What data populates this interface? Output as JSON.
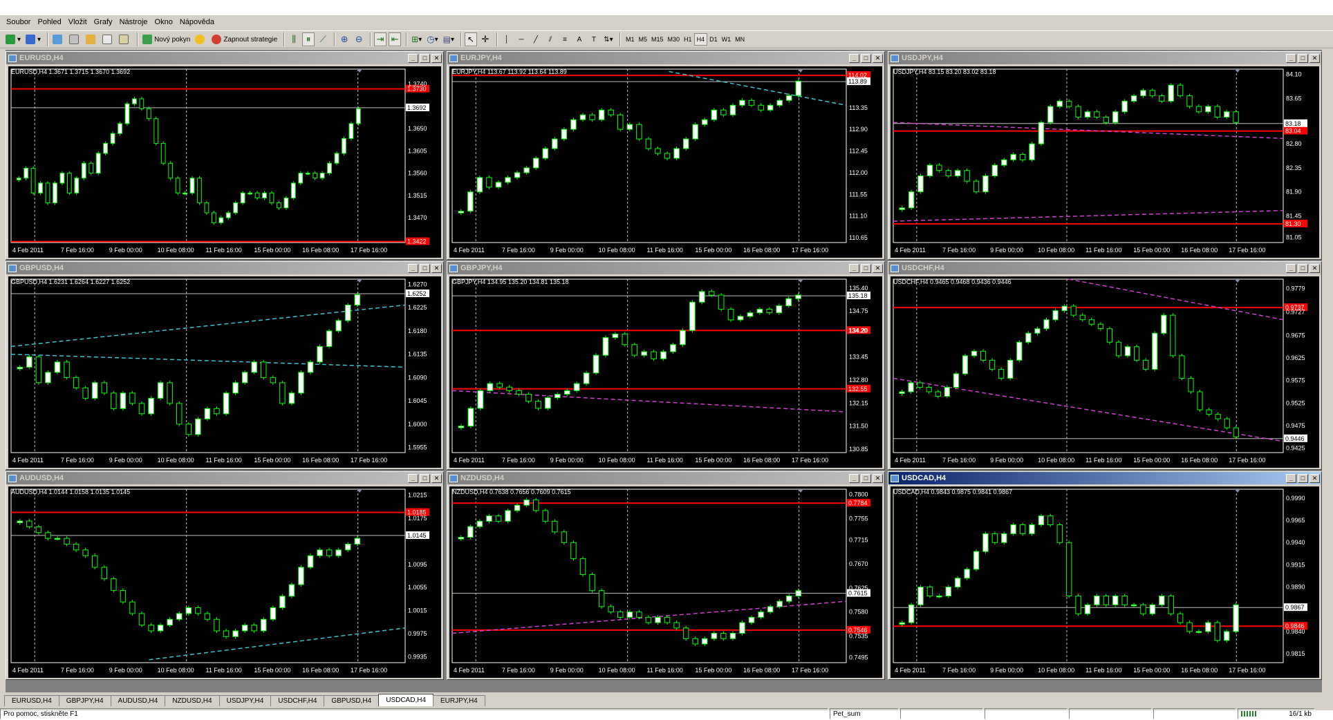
{
  "menu": [
    "Soubor",
    "Pohled",
    "Vložit",
    "Grafy",
    "Nástroje",
    "Okno",
    "Nápověda"
  ],
  "toolbar": {
    "new_order": "Nový pokyn",
    "start_strategies": "Zapnout strategie",
    "timeframes": [
      "M1",
      "M5",
      "M15",
      "M30",
      "H1",
      "H4",
      "D1",
      "W1",
      "MN"
    ],
    "active_timeframe": "H4"
  },
  "xaxis_labels": [
    "4 Feb 2011",
    "7 Feb 16:00",
    "9 Feb 00:00",
    "10 Feb 08:00",
    "11 Feb 16:00",
    "15 Feb 00:00",
    "16 Feb 08:00",
    "17 Feb 16:00"
  ],
  "colors": {
    "bull": "#00ff00",
    "bull_body": "#ffffff",
    "bear": "#00ff00",
    "bear_body": "#000000",
    "hline": "#ff0000",
    "bid": "#c0c0c0",
    "trend_cyan": "#40c0d0",
    "trend_magenta": "#d040d0",
    "bg": "#000000",
    "axis": "#ffffff"
  },
  "windows": [
    {
      "title": "EURUSD,H4",
      "info": "EURUSD,H4  1.3671 1.3715 1.3670 1.3692",
      "active": false,
      "ylabels": [
        "1.3740",
        "1.3695",
        "1.3650",
        "1.3605",
        "1.3560",
        "1.3515",
        "1.3470"
      ],
      "ymin": 1.342,
      "ymax": 1.377,
      "price": "1.3692",
      "price_val": 1.3692,
      "redlines": [
        {
          "v": 1.373,
          "label": "1.3730"
        },
        {
          "v": 1.3422,
          "label": "1.3422"
        }
      ],
      "trend": [],
      "path": [
        1.355,
        1.357,
        1.352,
        1.354,
        1.35,
        1.354,
        1.356,
        1.352,
        1.355,
        1.358,
        1.356,
        1.36,
        1.362,
        1.364,
        1.366,
        1.37,
        1.371,
        1.369,
        1.367,
        1.362,
        1.358,
        1.355,
        1.352,
        1.352,
        1.355,
        1.35,
        1.348,
        1.346,
        1.347,
        1.348,
        1.35,
        1.352,
        1.352,
        1.351,
        1.352,
        1.35,
        1.349,
        1.351,
        1.354,
        1.356,
        1.356,
        1.355,
        1.356,
        1.358,
        1.36,
        1.363,
        1.366,
        1.369
      ]
    },
    {
      "title": "EURJPY,H4",
      "info": "EURJPY,H4  113.67 113.92 113.64 113.89",
      "active": false,
      "ylabels": [
        "113.89",
        "113.35",
        "112.90",
        "112.45",
        "112.00",
        "111.55",
        "111.10",
        "110.65"
      ],
      "ymin": 110.55,
      "ymax": 114.15,
      "price": "113.89",
      "price_val": 113.89,
      "redlines": [
        {
          "v": 114.02,
          "label": "114.02"
        }
      ],
      "trend": [
        {
          "x1": 0.55,
          "y1": 114.1,
          "x2": 1.0,
          "y2": 113.4,
          "c": "cyan"
        }
      ],
      "path": [
        111.2,
        111.6,
        111.9,
        111.7,
        111.8,
        111.9,
        112.0,
        112.1,
        112.3,
        112.5,
        112.7,
        112.9,
        113.1,
        113.2,
        113.1,
        113.3,
        113.2,
        112.9,
        113.0,
        112.7,
        112.5,
        112.4,
        112.3,
        112.5,
        112.7,
        113.0,
        113.1,
        113.3,
        113.2,
        113.4,
        113.5,
        113.4,
        113.3,
        113.4,
        113.5,
        113.6,
        113.9
      ]
    },
    {
      "title": "USDJPY,H4",
      "info": "USDJPY,H4  83.15 83.20 83.02 83.18",
      "active": false,
      "ylabels": [
        "84.10",
        "83.65",
        "83.18",
        "82.80",
        "82.35",
        "81.90",
        "81.45",
        "81.05"
      ],
      "ymin": 80.95,
      "ymax": 84.2,
      "price": "83.18",
      "price_val": 83.18,
      "redlines": [
        {
          "v": 83.04,
          "label": "83.04"
        },
        {
          "v": 81.3,
          "label": "81.30"
        }
      ],
      "trend": [
        {
          "x1": 0,
          "y1": 83.2,
          "x2": 1.0,
          "y2": 82.9,
          "c": "magenta"
        },
        {
          "x1": 0,
          "y1": 81.35,
          "x2": 1.0,
          "y2": 81.55,
          "c": "magenta"
        }
      ],
      "path": [
        81.6,
        81.9,
        82.2,
        82.4,
        82.3,
        82.2,
        82.3,
        82.1,
        81.9,
        82.2,
        82.4,
        82.5,
        82.6,
        82.5,
        82.8,
        83.2,
        83.5,
        83.6,
        83.5,
        83.3,
        83.4,
        83.3,
        83.2,
        83.4,
        83.6,
        83.7,
        83.8,
        83.7,
        83.6,
        83.9,
        83.7,
        83.5,
        83.4,
        83.5,
        83.3,
        83.4,
        83.2
      ]
    },
    {
      "title": "GBPUSD,H4",
      "info": "GBPUSD,H4  1.6231 1.6264 1.6227 1.6252",
      "active": false,
      "ylabels": [
        "1.6270",
        "1.6225",
        "1.6180",
        "1.6135",
        "1.6090",
        "1.6045",
        "1.6000",
        "1.5955"
      ],
      "ymin": 1.5945,
      "ymax": 1.628,
      "price": "1.6252",
      "price_val": 1.6252,
      "redlines": [],
      "trend": [
        {
          "x1": 0,
          "y1": 1.615,
          "x2": 1.0,
          "y2": 1.623,
          "c": "cyan"
        },
        {
          "x1": 0,
          "y1": 1.6135,
          "x2": 1.0,
          "y2": 1.611,
          "c": "cyan"
        }
      ],
      "path": [
        1.611,
        1.613,
        1.608,
        1.61,
        1.612,
        1.609,
        1.607,
        1.605,
        1.608,
        1.606,
        1.603,
        1.606,
        1.604,
        1.602,
        1.605,
        1.608,
        1.604,
        1.6,
        1.598,
        1.601,
        1.603,
        1.602,
        1.606,
        1.608,
        1.61,
        1.612,
        1.609,
        1.608,
        1.604,
        1.606,
        1.61,
        1.612,
        1.615,
        1.618,
        1.62,
        1.623,
        1.625
      ]
    },
    {
      "title": "GBPJPY,H4",
      "info": "GBPJPY,H4  134.95 135.20 134.81 135.18",
      "active": false,
      "ylabels": [
        "135.40",
        "135.18",
        "134.75",
        "134.20",
        "133.45",
        "132.80",
        "132.15",
        "131.50",
        "130.85"
      ],
      "ymin": 130.75,
      "ymax": 135.65,
      "price": "135.18",
      "price_val": 135.18,
      "redlines": [
        {
          "v": 134.2,
          "label": "134.20"
        },
        {
          "v": 132.55,
          "label": "132.55"
        }
      ],
      "trend": [
        {
          "x1": 0,
          "y1": 132.5,
          "x2": 1.0,
          "y2": 131.9,
          "c": "magenta"
        }
      ],
      "path": [
        131.5,
        132.0,
        132.5,
        132.7,
        132.6,
        132.5,
        132.4,
        132.2,
        132.0,
        132.3,
        132.4,
        132.5,
        132.7,
        133.0,
        133.5,
        134.0,
        134.1,
        133.8,
        133.5,
        133.6,
        133.4,
        133.6,
        133.8,
        134.2,
        135.0,
        135.3,
        135.2,
        134.8,
        134.5,
        134.6,
        134.7,
        134.8,
        134.7,
        134.9,
        135.1,
        135.2
      ]
    },
    {
      "title": "USDCHF,H4",
      "info": "USDCHF,H4  0.9465 0.9468 0.9436 0.9446",
      "active": false,
      "ylabels": [
        "0.9779",
        "0.9727",
        "0.9675",
        "0.9625",
        "0.9575",
        "0.9525",
        "0.9475",
        "0.9446",
        "0.9425"
      ],
      "ymin": 0.9415,
      "ymax": 0.98,
      "price": "0.9446",
      "price_val": 0.9446,
      "redlines": [
        {
          "v": 0.9737,
          "label": "0.9737"
        }
      ],
      "trend": [
        {
          "x1": 0,
          "y1": 0.958,
          "x2": 1.0,
          "y2": 0.944,
          "c": "magenta"
        },
        {
          "x1": 0.45,
          "y1": 0.98,
          "x2": 1.0,
          "y2": 0.971,
          "c": "magenta"
        }
      ],
      "path": [
        0.955,
        0.957,
        0.956,
        0.955,
        0.954,
        0.956,
        0.959,
        0.963,
        0.964,
        0.962,
        0.96,
        0.958,
        0.962,
        0.966,
        0.968,
        0.969,
        0.971,
        0.973,
        0.974,
        0.972,
        0.971,
        0.97,
        0.969,
        0.966,
        0.963,
        0.965,
        0.962,
        0.96,
        0.968,
        0.972,
        0.963,
        0.958,
        0.955,
        0.951,
        0.95,
        0.949,
        0.947,
        0.945
      ]
    },
    {
      "title": "AUDUSD,H4",
      "info": "AUDUSD,H4  1.0144 1.0158 1.0135 1.0145",
      "active": false,
      "ylabels": [
        "1.0215",
        "1.0175",
        "1.0145",
        "1.0095",
        "1.0055",
        "1.0015",
        "0.9975",
        "0.9935"
      ],
      "ymin": 0.9925,
      "ymax": 1.0225,
      "price": "1.0145",
      "price_val": 1.0145,
      "redlines": [
        {
          "v": 1.0185,
          "label": "1.0185"
        }
      ],
      "trend": [
        {
          "x1": 0.35,
          "y1": 0.993,
          "x2": 1.0,
          "y2": 0.9985,
          "c": "cyan"
        }
      ],
      "path": [
        1.017,
        1.016,
        1.015,
        1.014,
        1.014,
        1.013,
        1.012,
        1.011,
        1.009,
        1.007,
        1.005,
        1.003,
        1.001,
        0.999,
        0.998,
        0.999,
        1.0,
        1.001,
        1.002,
        1.001,
        1.0,
        0.998,
        0.997,
        0.998,
        0.999,
        0.998,
        1.0,
        1.002,
        1.004,
        1.006,
        1.009,
        1.011,
        1.012,
        1.011,
        1.012,
        1.013,
        1.014
      ]
    },
    {
      "title": "NZDUSD,H4",
      "info": "NZDUSD,H4  0.7638 0.7656 0.7609 0.7615",
      "active": false,
      "ylabels": [
        "0.7800",
        "0.7755",
        "0.7715",
        "0.7670",
        "0.7625",
        "0.7580",
        "0.7535",
        "0.7495"
      ],
      "ymin": 0.7485,
      "ymax": 0.781,
      "price": "0.7615",
      "price_val": 0.7615,
      "redlines": [
        {
          "v": 0.7784,
          "label": "0.7784"
        },
        {
          "v": 0.7546,
          "label": "0.7546"
        }
      ],
      "trend": [
        {
          "x1": 0,
          "y1": 0.754,
          "x2": 1.0,
          "y2": 0.76,
          "c": "magenta"
        }
      ],
      "path": [
        0.772,
        0.774,
        0.775,
        0.776,
        0.775,
        0.777,
        0.778,
        0.779,
        0.777,
        0.775,
        0.773,
        0.771,
        0.768,
        0.765,
        0.762,
        0.759,
        0.758,
        0.757,
        0.758,
        0.757,
        0.756,
        0.757,
        0.756,
        0.755,
        0.753,
        0.752,
        0.753,
        0.754,
        0.753,
        0.754,
        0.756,
        0.757,
        0.758,
        0.759,
        0.76,
        0.761,
        0.762
      ]
    },
    {
      "title": "USDCAD,H4",
      "info": "USDCAD,H4  0.9843 0.9875 0.9841 0.9867",
      "active": true,
      "ylabels": [
        "0.9990",
        "0.9965",
        "0.9940",
        "0.9915",
        "0.9890",
        "0.9867",
        "0.9840",
        "0.9815"
      ],
      "ymin": 0.9805,
      "ymax": 1.0,
      "price": "0.9867",
      "price_val": 0.9867,
      "redlines": [
        {
          "v": 0.9846,
          "label": "0.9846"
        }
      ],
      "trend": [],
      "path": [
        0.985,
        0.987,
        0.989,
        0.988,
        0.988,
        0.989,
        0.99,
        0.991,
        0.993,
        0.995,
        0.994,
        0.995,
        0.996,
        0.995,
        0.996,
        0.997,
        0.996,
        0.994,
        0.988,
        0.986,
        0.987,
        0.988,
        0.987,
        0.988,
        0.987,
        0.987,
        0.986,
        0.987,
        0.988,
        0.986,
        0.985,
        0.984,
        0.984,
        0.985,
        0.983,
        0.984,
        0.987
      ]
    }
  ],
  "tabs": [
    "EURUSD,H4",
    "GBPJPY,H4",
    "AUDUSD,H4",
    "NZDUSD,H4",
    "USDJPY,H4",
    "USDCHF,H4",
    "GBPUSD,H4",
    "USDCAD,H4",
    "EURJPY,H4"
  ],
  "active_tab": "USDCAD,H4",
  "status": {
    "help": "Pro pomoc, stiskněte F1",
    "profile": "Pet_sum",
    "traffic": "16/1 kb"
  }
}
